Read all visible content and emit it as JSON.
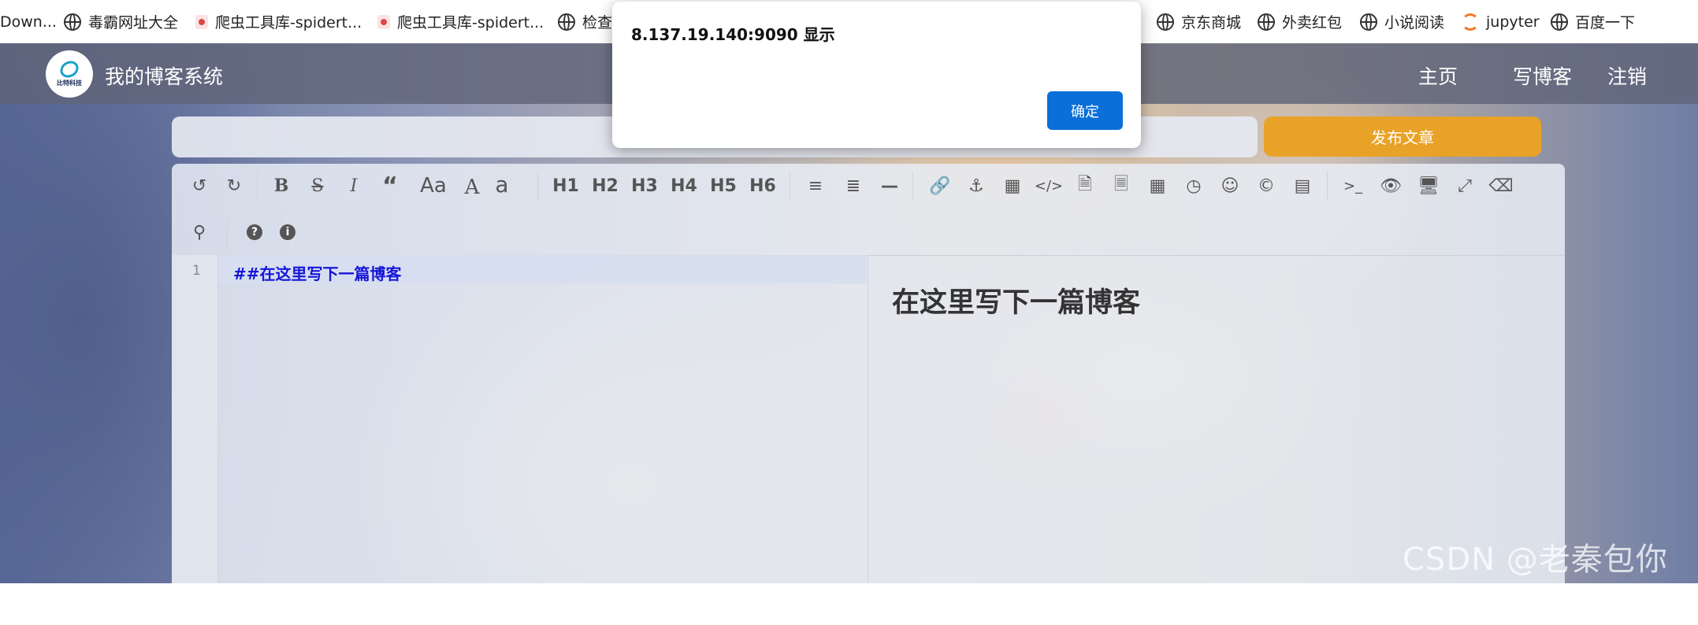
{
  "bookmarks": [
    {
      "label": "Down...",
      "icon": "none"
    },
    {
      "label": "毒霸网址大全",
      "icon": "globe-icon"
    },
    {
      "label": "爬虫工具库-spidert...",
      "icon": "spider-icon"
    },
    {
      "label": "爬虫工具库-spidert...",
      "icon": "spider-icon"
    },
    {
      "label": "检查",
      "icon": "globe-icon"
    },
    {
      "label": "京东商城",
      "icon": "globe-icon"
    },
    {
      "label": "外卖红包",
      "icon": "globe-icon"
    },
    {
      "label": "小说阅读",
      "icon": "globe-icon"
    },
    {
      "label": "jupyter",
      "icon": "jupyter-icon"
    },
    {
      "label": "百度一下",
      "icon": "globe-icon"
    }
  ],
  "header": {
    "logo_text": "比特科技",
    "site_title": "我的博客系统",
    "nav": [
      "主页",
      "写博客",
      "注销"
    ]
  },
  "form": {
    "title_value": "",
    "publish_label": "发布文章"
  },
  "toolbar": {
    "text_buttons": [
      "Aa",
      "A",
      "a",
      "H1",
      "H2",
      "H3",
      "H4",
      "H5",
      "H6"
    ],
    "icons": [
      "undo-icon",
      "redo-icon",
      "bold-icon",
      "strikethrough-icon",
      "italic-icon",
      "quote-icon",
      "uppercase-icon",
      "ucwords-icon",
      "lowercase-icon",
      "h1",
      "h2",
      "h3",
      "h4",
      "h5",
      "h6",
      "unordered-list-icon",
      "ordered-list-icon",
      "hr-icon",
      "link-icon",
      "anchor-icon",
      "image-icon",
      "code-icon",
      "preformatted-code-icon",
      "code-block-icon",
      "table-icon",
      "datetime-icon",
      "emoji-icon",
      "html-entities-icon",
      "pagebreak-icon",
      "goto-line-icon",
      "watch-icon",
      "preview-icon",
      "fullscreen-icon",
      "clear-icon",
      "search-icon",
      "help-icon",
      "info-icon"
    ]
  },
  "editor": {
    "line_number": "1",
    "code": "##在这里写下一篇博客",
    "preview_heading": "在这里写下一篇博客"
  },
  "alert": {
    "title": "8.137.19.140:9090 显示",
    "ok_label": "确定"
  },
  "watermark": "CSDN @老秦包你会",
  "colors": {
    "publish": "#e8a227",
    "alert_button": "#0a6fd8",
    "code": "#1515d8"
  }
}
